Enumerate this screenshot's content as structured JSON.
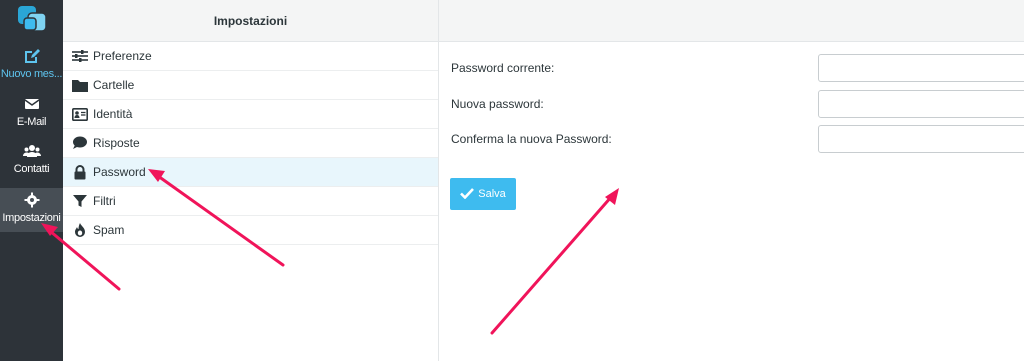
{
  "rail": {
    "items": [
      {
        "label": "Nuovo mes...",
        "icon": "compose-icon"
      },
      {
        "label": "E-Mail",
        "icon": "envelope-icon"
      },
      {
        "label": "Contatti",
        "icon": "contacts-icon"
      },
      {
        "label": "Impostazioni",
        "icon": "gear-icon"
      }
    ]
  },
  "settings": {
    "title": "Impostazioni",
    "items": [
      {
        "label": "Preferenze",
        "icon": "sliders-icon"
      },
      {
        "label": "Cartelle",
        "icon": "folder-icon"
      },
      {
        "label": "Identità",
        "icon": "id-card-icon"
      },
      {
        "label": "Risposte",
        "icon": "speech-bubble-icon"
      },
      {
        "label": "Password",
        "icon": "lock-icon",
        "selected": true
      },
      {
        "label": "Filtri",
        "icon": "filter-icon"
      },
      {
        "label": "Spam",
        "icon": "flame-icon"
      }
    ]
  },
  "form": {
    "current_label": "Password corrente:",
    "current_value": "",
    "new_label": "Nuova password:",
    "new_value": "",
    "confirm_label": "Conferma la nuova Password:",
    "confirm_value": "",
    "save_label": "Salva"
  },
  "colors": {
    "rail_bg": "#2d3339",
    "accent": "#3ebbef",
    "selected_row": "#e8f6fc",
    "annotation_arrow": "#f0145a"
  }
}
